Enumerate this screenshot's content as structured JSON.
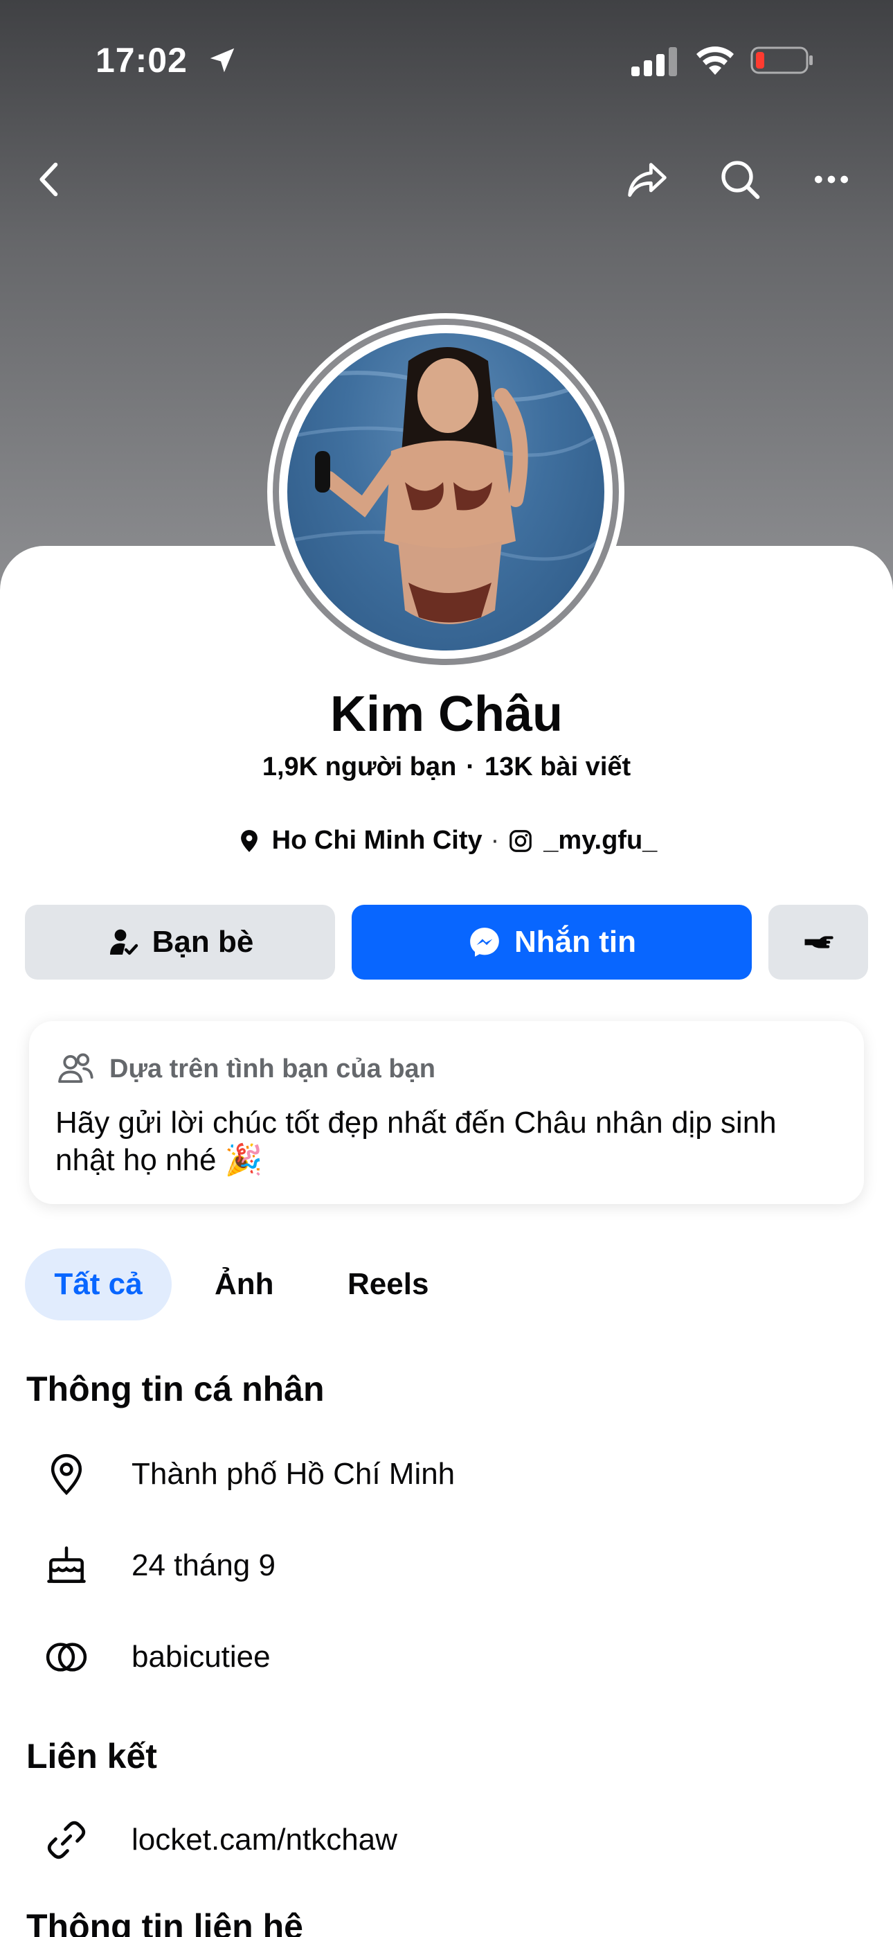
{
  "status_bar": {
    "time": "17:02"
  },
  "profile": {
    "name": "Kim Châu",
    "friends": "1,9K người bạn",
    "posts": "13K bài viết",
    "city": "Ho Chi Minh City",
    "instagram": "_my.gfu_"
  },
  "actions": {
    "friends_label": "Bạn bè",
    "message_label": "Nhắn tin"
  },
  "suggestion": {
    "heading": "Dựa trên tình bạn của bạn",
    "text": "Hãy gửi lời chúc tốt đẹp nhất đến Châu nhân dịp sinh nhật họ nhé 🎉"
  },
  "tabs": [
    {
      "label": "Tất cả"
    },
    {
      "label": "Ảnh"
    },
    {
      "label": "Reels"
    }
  ],
  "personal_info": {
    "title": "Thông tin cá nhân",
    "items": [
      {
        "label": "Thành phố Hồ Chí Minh"
      },
      {
        "label": "24 tháng 9"
      },
      {
        "label": "babicutiee"
      }
    ]
  },
  "links": {
    "title": "Liên kết",
    "items": [
      {
        "label": "locket.cam/ntkchaw"
      }
    ]
  },
  "contact": {
    "title": "Thông tin liên hệ"
  },
  "colors": {
    "accent": "#0866ff",
    "chip": "#e2e5e9",
    "tab_active_bg": "#e1ecfd"
  }
}
